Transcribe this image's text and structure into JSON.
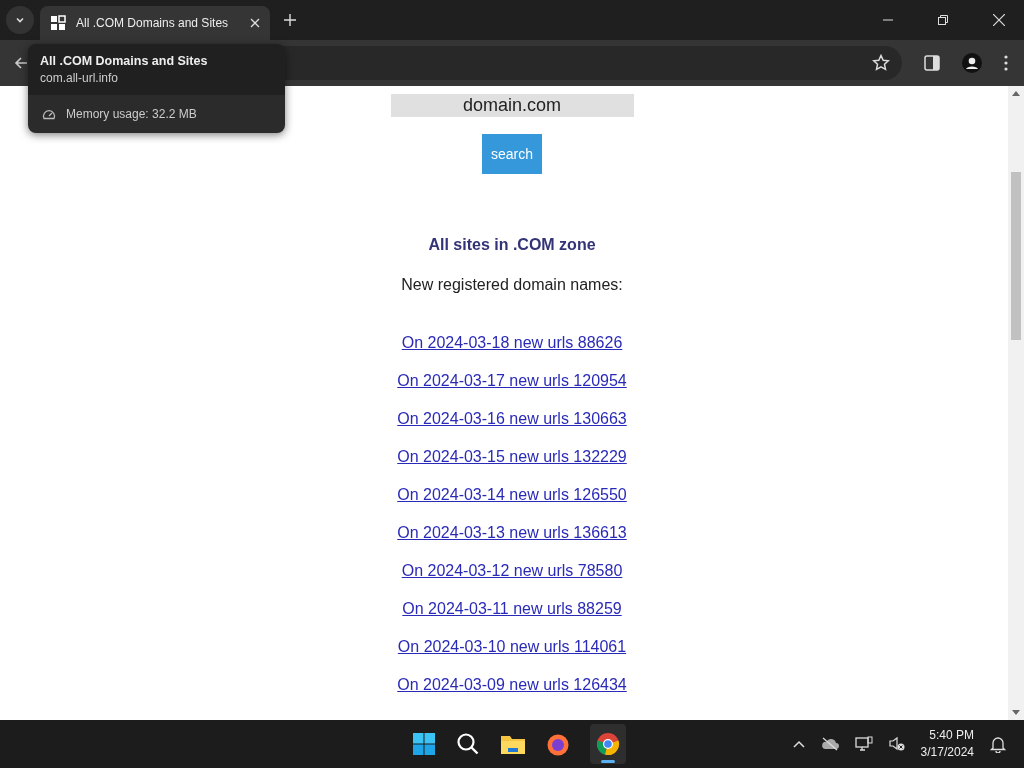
{
  "browser": {
    "tab": {
      "title": "All .COM Domains and Sites",
      "selected": true
    },
    "tab_hover_card": {
      "title": "All .COM Domains and Sites",
      "url": "com.all-url.info",
      "memory": "Memory usage: 32.2 MB"
    }
  },
  "page": {
    "search": {
      "value": "domain.com",
      "button": "search"
    },
    "heading": "All sites in .COM zone",
    "subheading": "New registered domain names:",
    "links": [
      "On 2024-03-18 new urls 88626",
      "On 2024-03-17 new urls 120954",
      "On 2024-03-16 new urls 130663",
      "On 2024-03-15 new urls 132229",
      "On 2024-03-14 new urls 126550",
      "On 2024-03-13 new urls 136613",
      "On 2024-03-12 new urls 78580",
      "On 2024-03-11 new urls 88259",
      "On 2024-03-10 new urls 114061",
      "On 2024-03-09 new urls 126434"
    ]
  },
  "taskbar": {
    "time": "5:40 PM",
    "date": "3/17/2024"
  }
}
